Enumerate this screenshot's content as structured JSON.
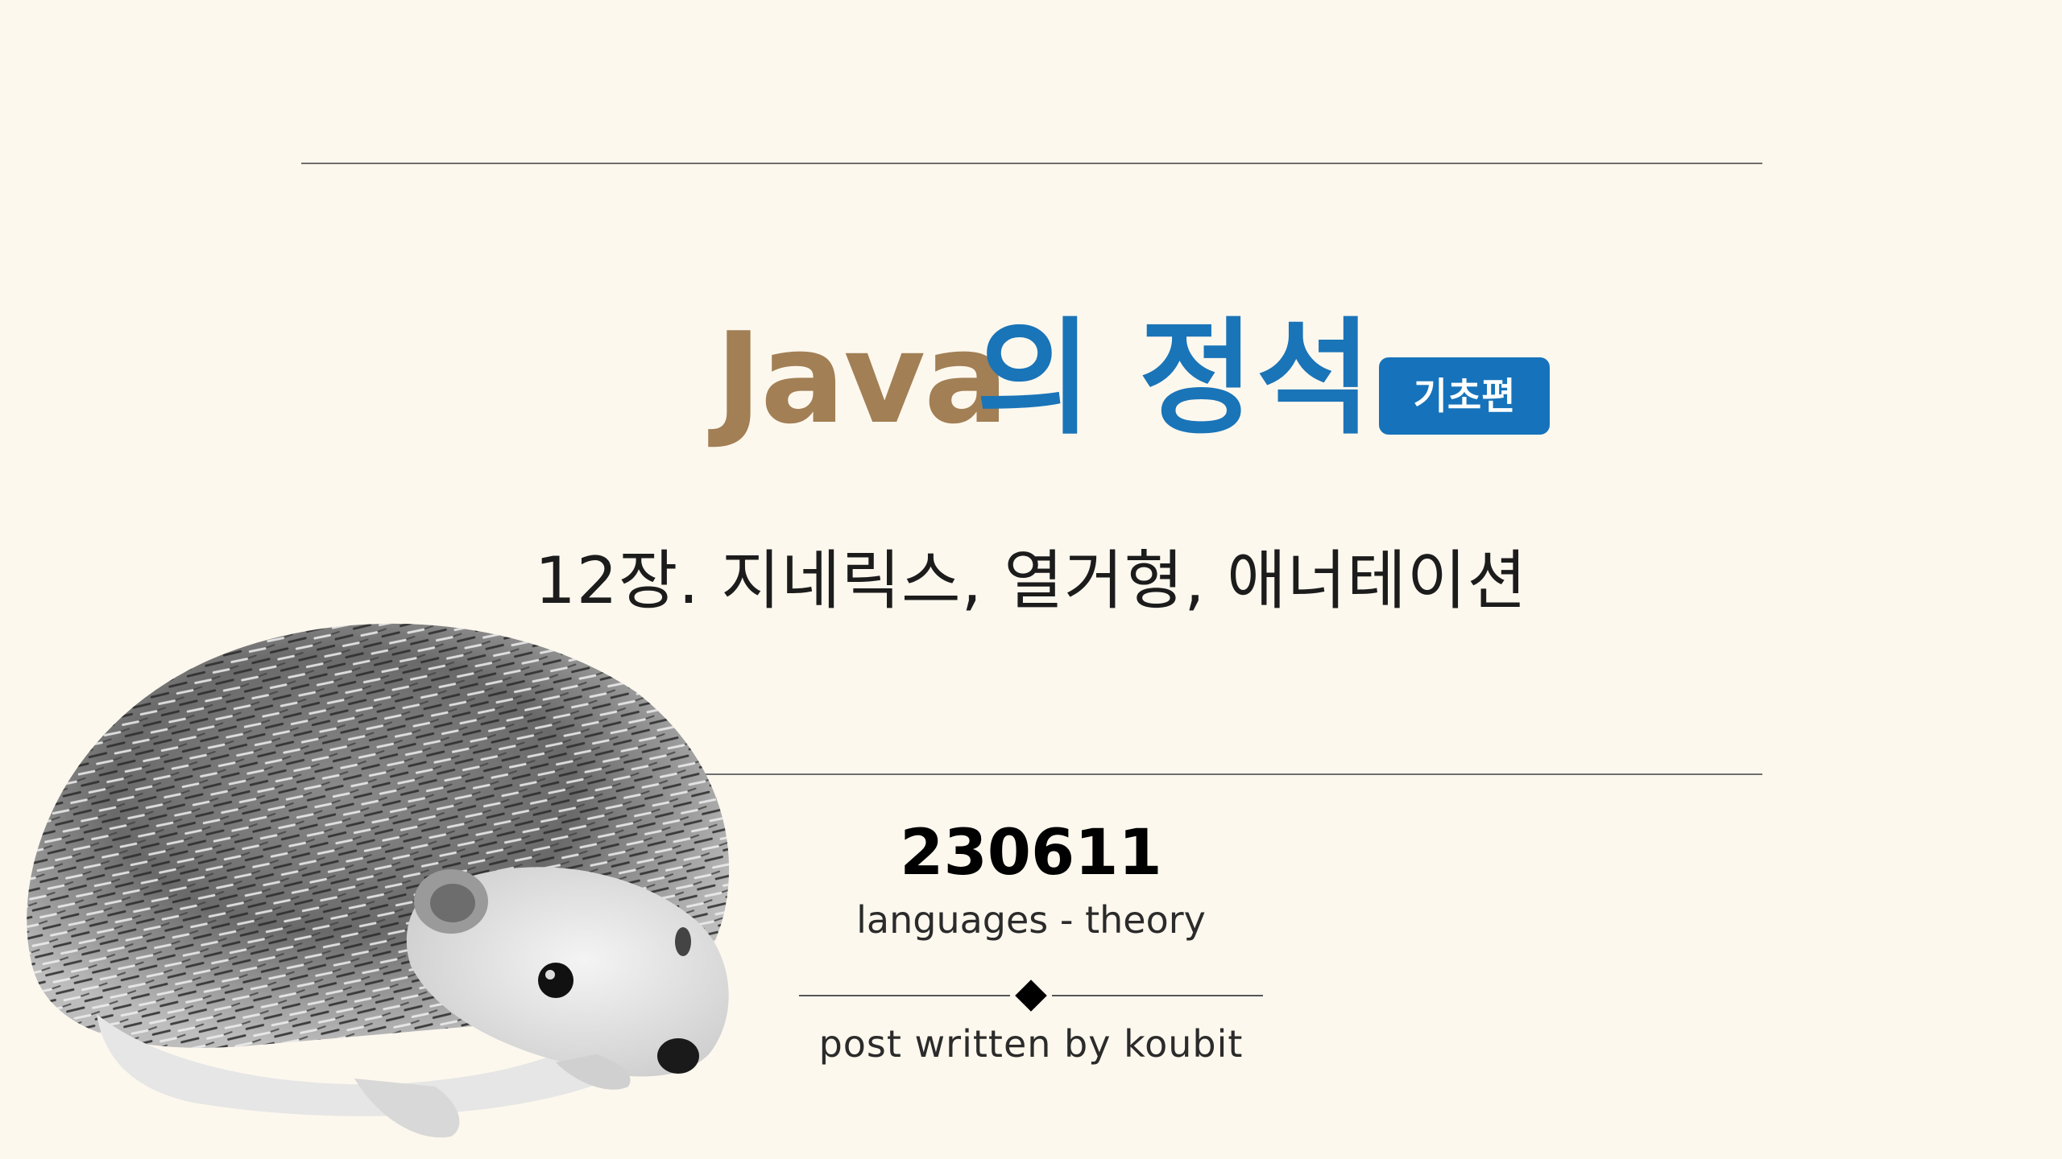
{
  "cover": {
    "title_java": "Java",
    "title_rest": "의 정석",
    "badge": "기초편",
    "subtitle": "12장. 지네릭스, 열거형, 애너테이션",
    "date": "230611",
    "category": "languages - theory",
    "author": "post written by koubit"
  },
  "colors": {
    "background": "#fdf8ee",
    "java_brown": "#a27f55",
    "title_blue": "#1a74b8",
    "badge_blue": "#1673bb"
  },
  "illustration": {
    "icon": "hedgehog-illustration"
  }
}
